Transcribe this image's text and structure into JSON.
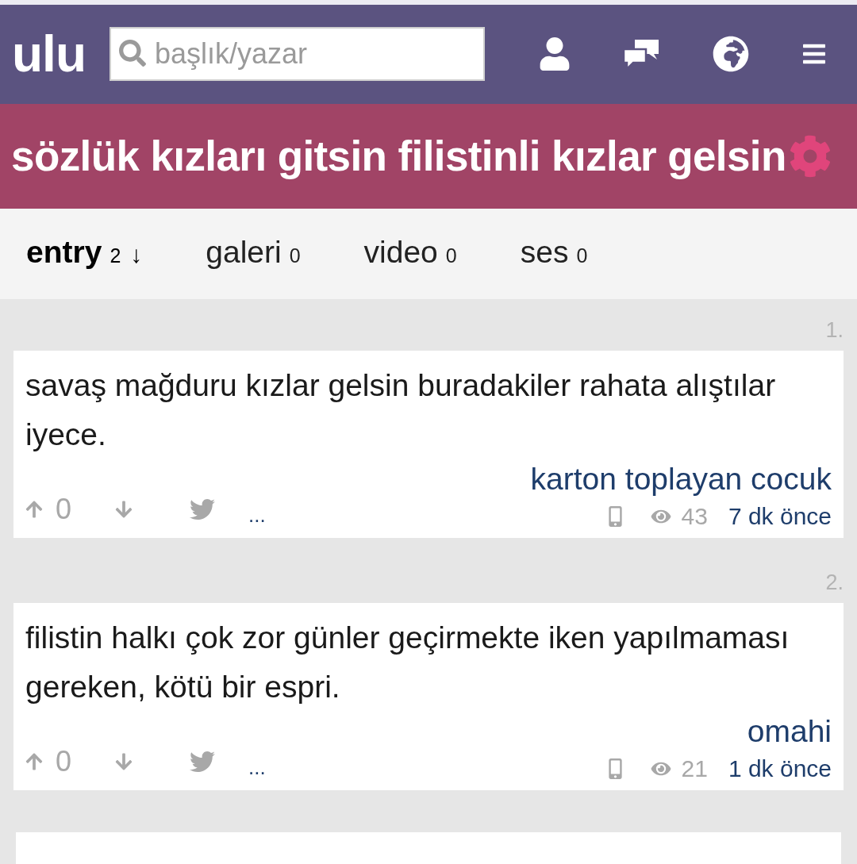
{
  "header": {
    "logo": "ulu",
    "search": {
      "placeholder": "başlık/yazar"
    }
  },
  "topic": {
    "title": "sözlük kızları gitsin filistinli kızlar gelsin"
  },
  "tabs": [
    {
      "label": "entry",
      "count": "2",
      "sort": "↓",
      "selected": true
    },
    {
      "label": "galeri",
      "count": "0",
      "selected": false
    },
    {
      "label": "video",
      "count": "0",
      "selected": false
    },
    {
      "label": "ses",
      "count": "0",
      "selected": false
    }
  ],
  "entries": [
    {
      "number": "1.",
      "text": "savaş mağduru kızlar gelsin buradakiler rahata alıştılar iyece.",
      "votes": "0",
      "more": "...",
      "author": "karton toplayan cocuk",
      "views": "43",
      "time": "7 dk önce"
    },
    {
      "number": "2.",
      "text": "filistin halkı çok zor günler geçirmekte iken yapılmaması gereken, kötü bir espri.",
      "votes": "0",
      "more": "...",
      "author": "omahi",
      "views": "21",
      "time": "1 dk önce"
    }
  ]
}
